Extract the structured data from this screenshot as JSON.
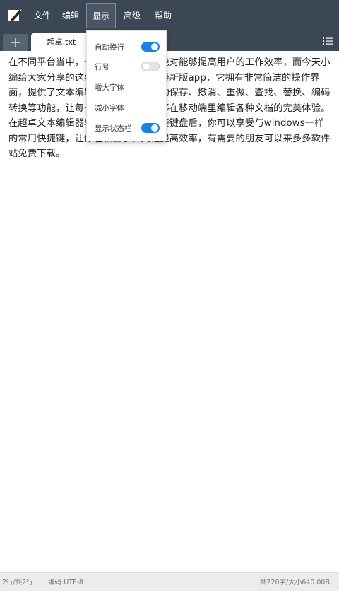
{
  "menubar": {
    "items": [
      {
        "label": "文件"
      },
      {
        "label": "编辑"
      },
      {
        "label": "显示"
      },
      {
        "label": "高级"
      },
      {
        "label": "帮助"
      }
    ],
    "active": "显示"
  },
  "tabs": {
    "add_label": "+",
    "active_tab": "超卓.txt"
  },
  "editor": {
    "content": "在不同平台当中，一款好用的编辑器绝对能够提高用户的工作效率，而今天小编给大家分享的这款超卓文本编辑器最新版app，它拥有非常简洁的操作界面，提供了文本编辑、菜单操作、自动保存、撤消、重做、查找、替换、编码转换等功能，让每一位手机用户都能够在移动端里编辑各种文档的完美体验。在超卓文本编辑器软件中还有设备连接键盘后，你可以享受与windows一样的常用快捷键，让你轻松上手，大幅提高效率，有需要的朋友可以来多多软件站免费下载。"
  },
  "display_menu": {
    "items": [
      {
        "label": "自动换行",
        "toggle": true
      },
      {
        "label": "行号",
        "toggle": false
      },
      {
        "label": "增大字体"
      },
      {
        "label": "减小字体"
      },
      {
        "label": "显示状态栏",
        "toggle": true
      }
    ]
  },
  "statusbar": {
    "position": "2行/共2行",
    "encoding": "编码:UTF-8",
    "stats": "共220字/大小640.00B"
  },
  "colors": {
    "menubar_bg": "#3b4755",
    "toggle_on": "#1a82e6",
    "statusbar_bg": "#ececec"
  },
  "icons": {
    "app": "notepad-pen-icon",
    "list": "list-icon"
  }
}
